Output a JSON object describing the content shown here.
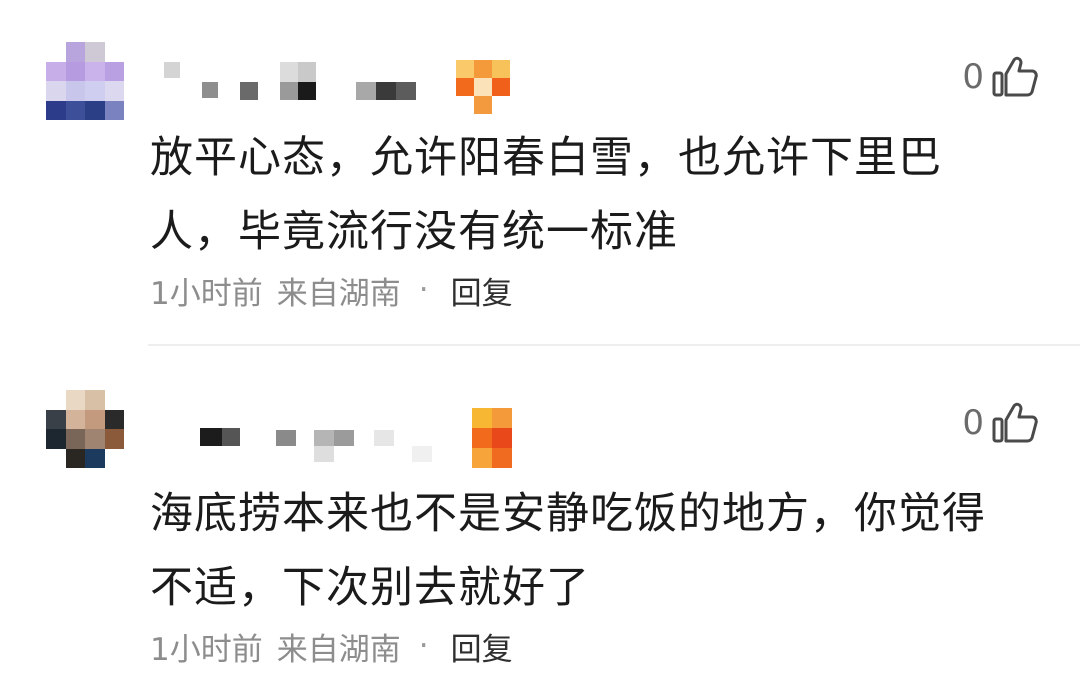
{
  "comments": [
    {
      "text_line1": "放平心态，允许阳春白雪，也允许下里巴",
      "text_line2": "人，毕竟流行没有统一标准",
      "time": "1小时前",
      "location": "来自湖南",
      "separator": "·",
      "reply_label": "回复",
      "like_count": "0",
      "like_icon": "thumbs-up-icon"
    },
    {
      "text_line1": "海底捞本来也不是安静吃饭的地方，你觉得",
      "text_line2": "不适，下次别去就好了",
      "time": "1小时前",
      "location": "来自湖南",
      "separator": "·",
      "reply_label": "回复",
      "like_count": "0",
      "like_icon": "thumbs-up-icon"
    }
  ],
  "colors": {
    "text_primary": "#1b1b1b",
    "text_secondary": "#8d8d8d",
    "badge_orange": "#f26b1d",
    "badge_yellow": "#f7b733"
  }
}
